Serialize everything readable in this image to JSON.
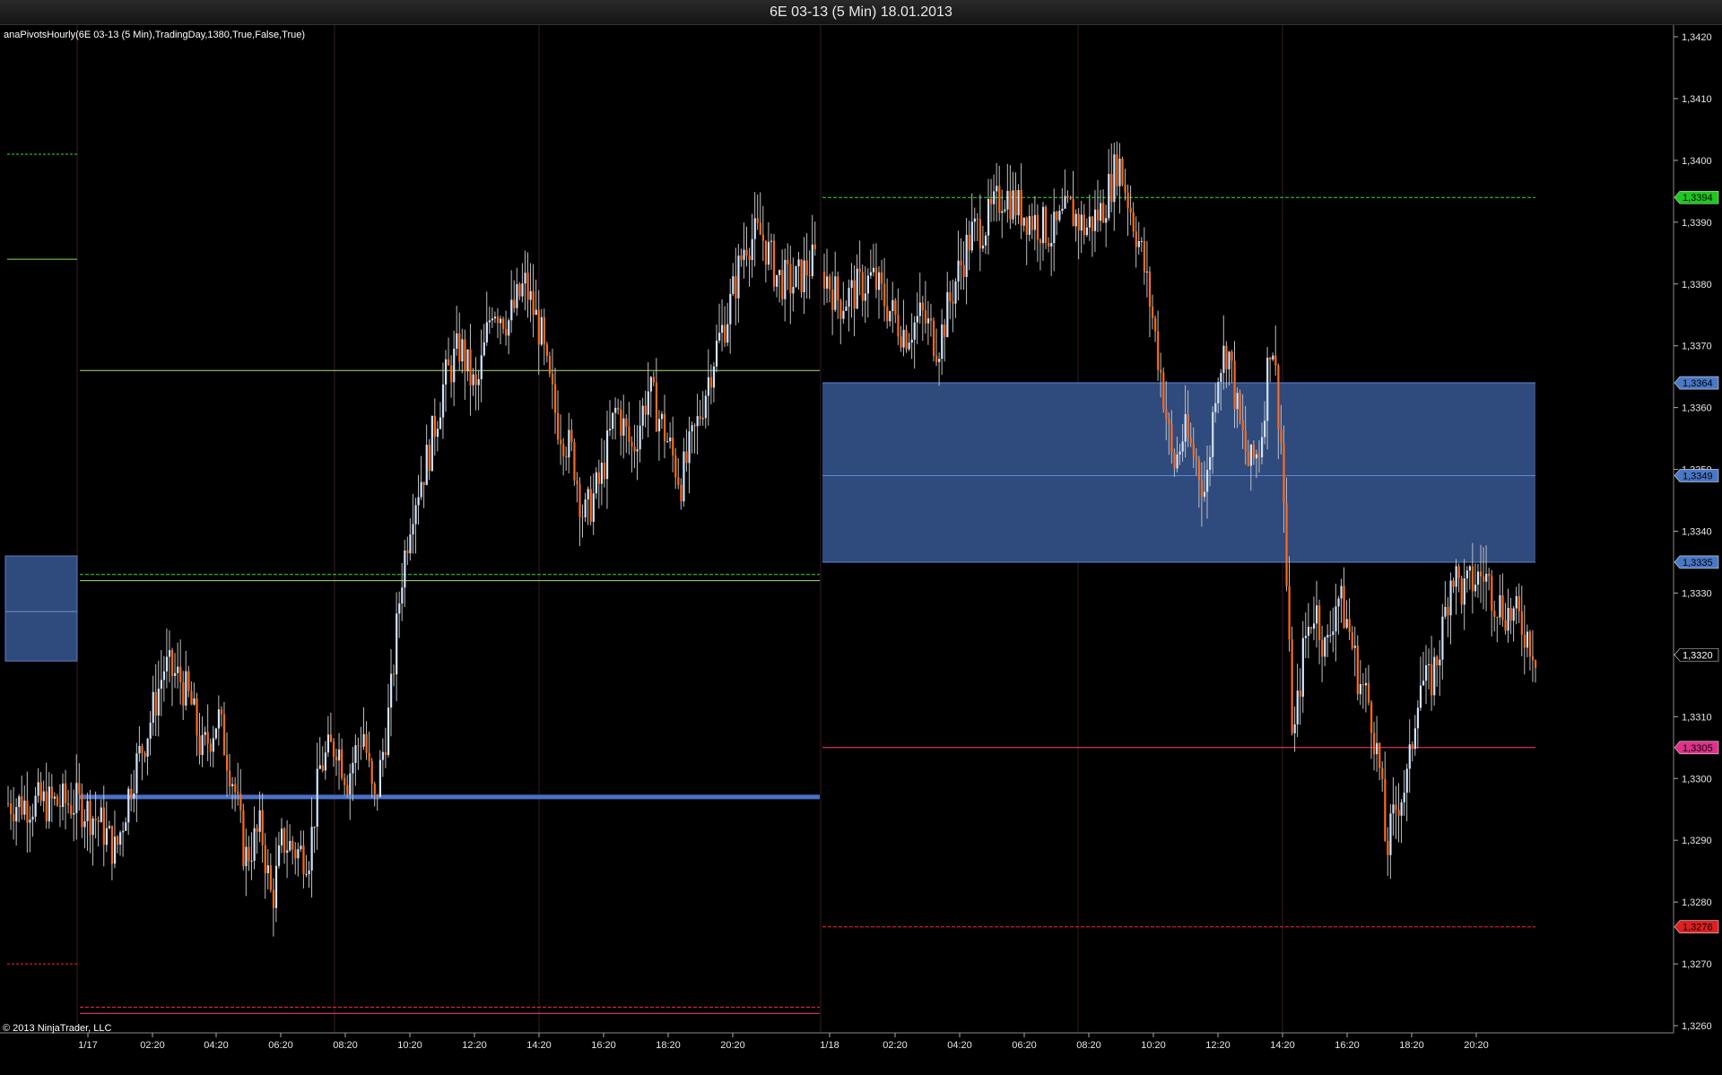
{
  "window": {
    "title": "6E 03-13 (5 Min)  18.01.2013"
  },
  "indicator_label": "anaPivotsHourly(6E 03-13 (5 Min),TradingDay,1380,True,False,True)",
  "copyright": "© 2013 NinjaTrader, LLC",
  "colors": {
    "background": "#000000",
    "up_candle": "#cfe4ff",
    "down_candle": "#ff6a1a",
    "wick": "#bfbfbf",
    "pivot_zone": "#2f4a7c",
    "resistance": "#33dd33",
    "support": "#ff2244",
    "pivot_line": "#4a70c8"
  },
  "chart_data": {
    "type": "candlestick",
    "title": "6E 03-13 (5 Min)  18.01.2013",
    "ylim": [
      1.3257,
      1.3424
    ],
    "y_ticks": [
      "1,3420",
      "1,3410",
      "1,3400",
      "1,3390",
      "1,3380",
      "1,3370",
      "1,3360",
      "1,3350",
      "1,3340",
      "1,3330",
      "1,3320",
      "1,3310",
      "1,3300",
      "1,3290",
      "1,3280",
      "1,3270",
      "1,3260"
    ],
    "x_ticks": [
      "1/17",
      "02:20",
      "04:20",
      "06:20",
      "08:20",
      "10:20",
      "12:20",
      "14:20",
      "16:20",
      "18:20",
      "20:20",
      "1/18",
      "02:20",
      "04:20",
      "06:20",
      "08:20",
      "10:20",
      "12:20",
      "14:20",
      "16:20",
      "18:20",
      "20:20"
    ],
    "session_day1": {
      "label": "1/17",
      "close_path": [
        [
          "00:00",
          1.3296
        ],
        [
          "00:40",
          1.3293
        ],
        [
          "01:10",
          1.3288
        ],
        [
          "01:40",
          1.33
        ],
        [
          "02:10",
          1.3308
        ],
        [
          "02:40",
          1.3318
        ],
        [
          "03:10",
          1.3316
        ],
        [
          "03:30",
          1.3312
        ],
        [
          "03:50",
          1.3304
        ],
        [
          "04:20",
          1.331
        ],
        [
          "04:50",
          1.3299
        ],
        [
          "05:10",
          1.3287
        ],
        [
          "05:40",
          1.3292
        ],
        [
          "06:00",
          1.328
        ],
        [
          "06:20",
          1.329
        ],
        [
          "06:50",
          1.3288
        ],
        [
          "07:10",
          1.3288
        ],
        [
          "07:30",
          1.3302
        ],
        [
          "08:00",
          1.3306
        ],
        [
          "08:20",
          1.33
        ],
        [
          "08:50",
          1.3308
        ],
        [
          "09:10",
          1.3295
        ],
        [
          "09:40",
          1.3312
        ],
        [
          "10:00",
          1.3332
        ],
        [
          "10:20",
          1.3344
        ],
        [
          "10:50",
          1.3352
        ],
        [
          "11:20",
          1.3364
        ],
        [
          "11:50",
          1.337
        ],
        [
          "12:20",
          1.3362
        ],
        [
          "12:50",
          1.3377
        ],
        [
          "13:20",
          1.3374
        ],
        [
          "13:50",
          1.338
        ],
        [
          "14:20",
          1.3372
        ],
        [
          "14:30",
          1.3366
        ],
        [
          "14:50",
          1.3358
        ],
        [
          "15:20",
          1.3352
        ],
        [
          "15:40",
          1.3342
        ],
        [
          "16:10",
          1.3348
        ],
        [
          "16:40",
          1.336
        ],
        [
          "17:10",
          1.3353
        ],
        [
          "17:40",
          1.3363
        ],
        [
          "18:10",
          1.3356
        ],
        [
          "18:40",
          1.3348
        ],
        [
          "19:10",
          1.3357
        ],
        [
          "19:40",
          1.3368
        ],
        [
          "20:10",
          1.3376
        ],
        [
          "20:40",
          1.3387
        ],
        [
          "21:10",
          1.3388
        ],
        [
          "21:40",
          1.3381
        ],
        [
          "22:10",
          1.338
        ],
        [
          "22:40",
          1.3383
        ],
        [
          "23:10",
          1.3386
        ],
        [
          "23:40",
          1.3382
        ]
      ]
    },
    "session_day2": {
      "label": "1/18",
      "close_path": [
        [
          "00:00",
          1.3382
        ],
        [
          "00:30",
          1.3377
        ],
        [
          "01:00",
          1.3379
        ],
        [
          "01:30",
          1.3381
        ],
        [
          "02:00",
          1.3376
        ],
        [
          "02:30",
          1.3372
        ],
        [
          "03:00",
          1.3375
        ],
        [
          "03:30",
          1.337
        ],
        [
          "04:00",
          1.338
        ],
        [
          "04:30",
          1.3388
        ],
        [
          "05:00",
          1.339
        ],
        [
          "05:30",
          1.3395
        ],
        [
          "06:00",
          1.3392
        ],
        [
          "06:30",
          1.339
        ],
        [
          "07:00",
          1.3388
        ],
        [
          "07:30",
          1.3392
        ],
        [
          "08:00",
          1.3389
        ],
        [
          "08:30",
          1.3392
        ],
        [
          "09:00",
          1.34
        ],
        [
          "09:20",
          1.3393
        ],
        [
          "09:40",
          1.3386
        ],
        [
          "10:00",
          1.3376
        ],
        [
          "10:20",
          1.3364
        ],
        [
          "10:40",
          1.335
        ],
        [
          "11:00",
          1.3356
        ],
        [
          "11:20",
          1.3352
        ],
        [
          "11:40",
          1.3346
        ],
        [
          "12:00",
          1.3366
        ],
        [
          "12:20",
          1.337
        ],
        [
          "12:40",
          1.3358
        ],
        [
          "13:00",
          1.335
        ],
        [
          "13:20",
          1.3354
        ],
        [
          "13:40",
          1.3373
        ],
        [
          "14:00",
          1.3352
        ],
        [
          "14:10",
          1.3325
        ],
        [
          "14:20",
          1.3305
        ],
        [
          "14:40",
          1.3322
        ],
        [
          "15:00",
          1.3328
        ],
        [
          "15:20",
          1.332
        ],
        [
          "15:40",
          1.333
        ],
        [
          "16:00",
          1.3325
        ],
        [
          "16:20",
          1.3316
        ],
        [
          "16:40",
          1.3312
        ],
        [
          "17:00",
          1.33
        ],
        [
          "17:10",
          1.3288
        ],
        [
          "17:30",
          1.3296
        ],
        [
          "17:50",
          1.33
        ],
        [
          "18:10",
          1.3316
        ],
        [
          "18:30",
          1.3315
        ],
        [
          "18:50",
          1.3322
        ],
        [
          "19:10",
          1.3334
        ],
        [
          "19:30",
          1.333
        ],
        [
          "19:50",
          1.3332
        ],
        [
          "20:10",
          1.3333
        ],
        [
          "20:30",
          1.3329
        ],
        [
          "20:50",
          1.3327
        ],
        [
          "21:10",
          1.3326
        ],
        [
          "21:30",
          1.3323
        ],
        [
          "21:45",
          1.332
        ]
      ]
    },
    "levels_day1": [
      {
        "name": "R1",
        "value": 1.3366,
        "style": "solid",
        "color": "#a8e070"
      },
      {
        "name": "P-upper",
        "value": 1.3333,
        "style": "dashed",
        "color": "#33dd33"
      },
      {
        "name": "P-lower",
        "value": 1.3332,
        "style": "solid",
        "color": "#a8e070"
      },
      {
        "name": "pivot",
        "value": 1.3297,
        "style": "thick",
        "color": "#4a70c8"
      },
      {
        "name": "S-upper",
        "value": 1.3263,
        "style": "dashed",
        "color": "#ff2244"
      },
      {
        "name": "S-lower",
        "value": 1.3262,
        "style": "solid",
        "color": "#ff4488"
      }
    ],
    "levels_day2": [
      {
        "name": "R",
        "value": 1.3394,
        "label": "1,3394",
        "style": "dashed",
        "color": "#33dd33",
        "tag_bg": "#1ec81e"
      },
      {
        "name": "zone-top",
        "value": 1.3364,
        "label": "1,3364",
        "style": "solid",
        "color": "#5a8ad8",
        "tag_bg": "#4a78c8"
      },
      {
        "name": "zone-mid",
        "value": 1.3349,
        "label": "1,3349",
        "style": "solid",
        "color": "#5a8ad8",
        "tag_bg": "#4a78c8"
      },
      {
        "name": "zone-bottom",
        "value": 1.3335,
        "label": "1,3335",
        "style": "solid",
        "color": "#5a8ad8",
        "tag_bg": "#4a78c8"
      },
      {
        "name": "S1",
        "value": 1.3305,
        "label": "1,3305",
        "style": "solid",
        "color": "#ff4466",
        "tag_bg": "#e0308a"
      },
      {
        "name": "S2",
        "value": 1.3276,
        "label": "1,3276",
        "style": "dashed",
        "color": "#ff2233",
        "tag_bg": "#e02020"
      }
    ],
    "prev_session_levels": [
      {
        "value": 1.3401,
        "style": "dashed",
        "color": "#33dd33"
      },
      {
        "value": 1.3384,
        "style": "solid",
        "color": "#88dd55"
      },
      {
        "value": 1.3327,
        "style": "zone",
        "color": "#2f4a7c"
      },
      {
        "value": 1.327,
        "style": "dashed",
        "color": "#ff2244"
      }
    ],
    "prev_zone": [
      1.3319,
      1.3336
    ],
    "day2_zone": [
      1.3335,
      1.3364
    ],
    "last_price": {
      "value": 1.332,
      "label": "1,3320"
    }
  }
}
